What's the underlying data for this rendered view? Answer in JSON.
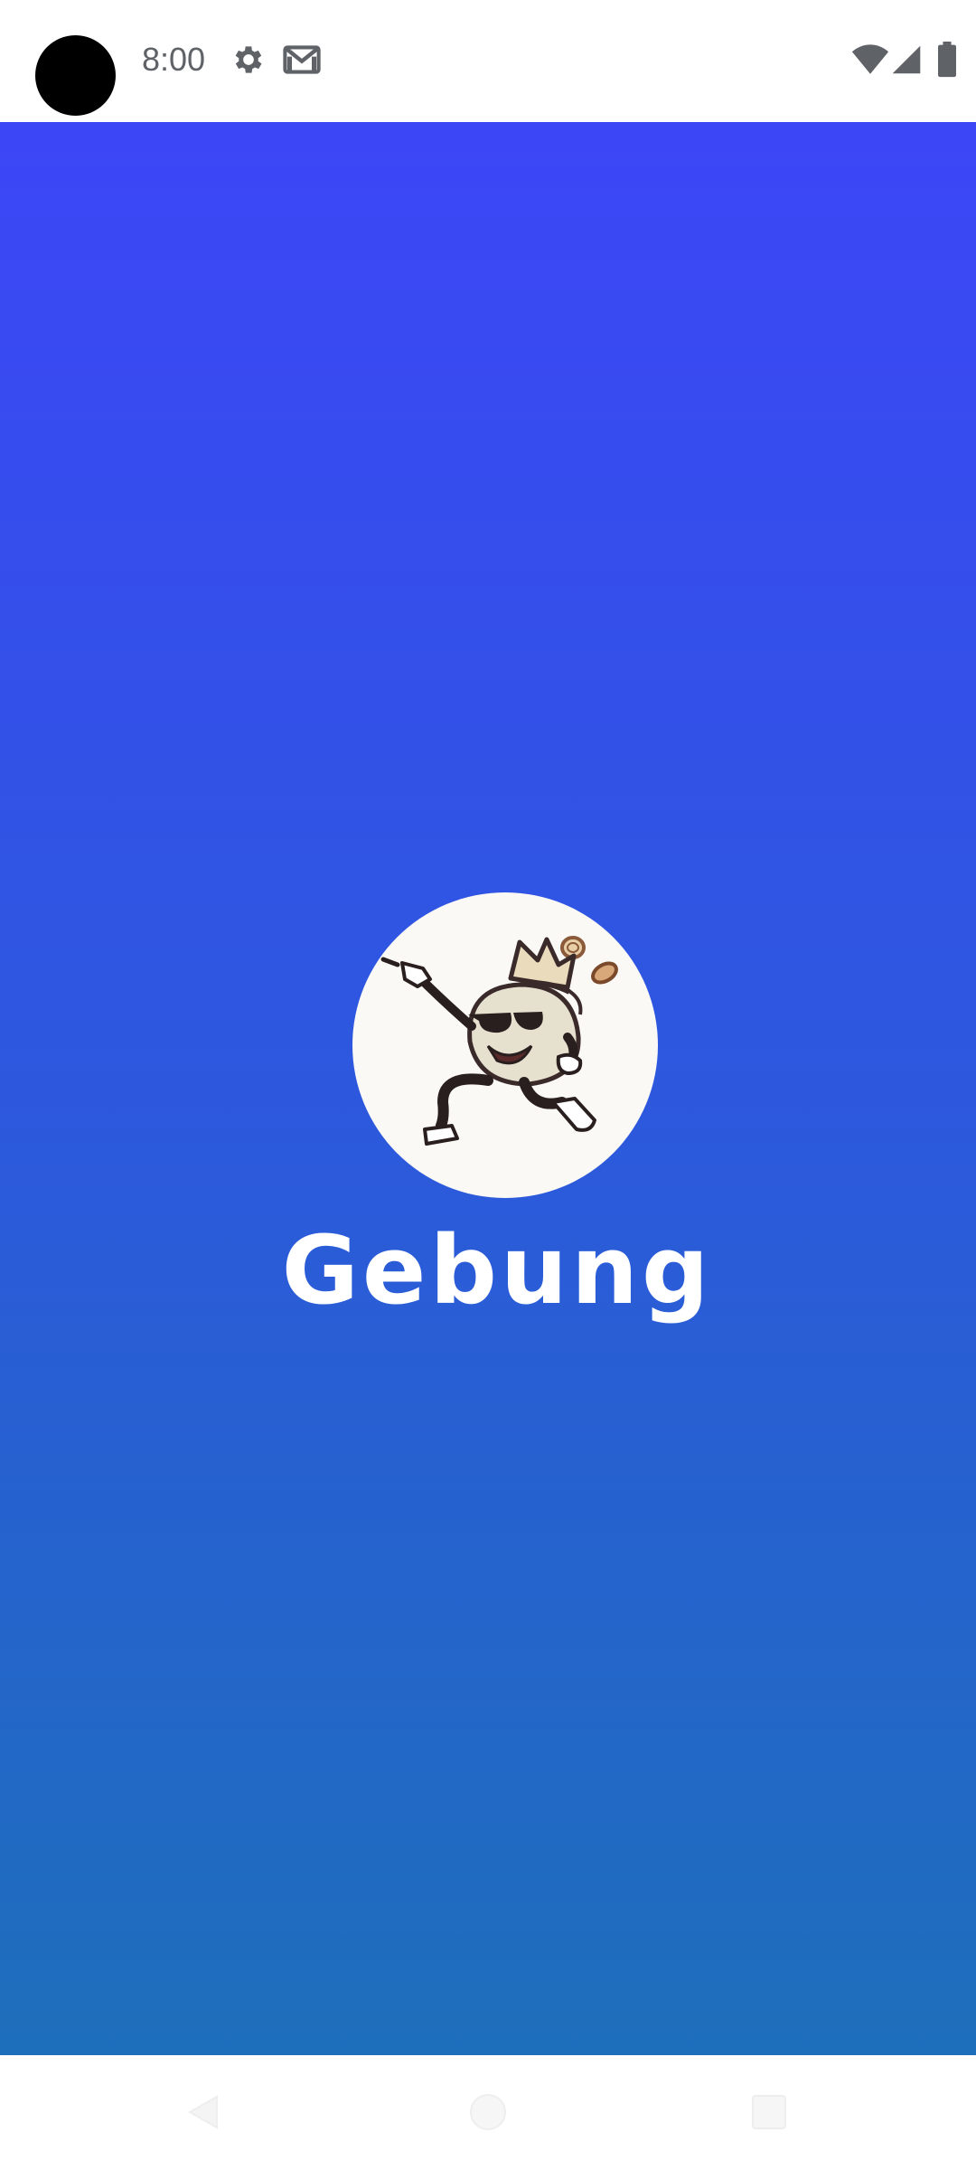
{
  "status_bar": {
    "time": "8:00",
    "icons": [
      "camera-cutout",
      "settings-icon",
      "gmail-icon",
      "wifi-icon",
      "cell-signal-icon",
      "battery-icon"
    ]
  },
  "splash": {
    "app_name": "Gebung",
    "logo": "money-bag-mascot-logo",
    "gradient_top": "#3c46f7",
    "gradient_bottom": "#1d6fbb"
  },
  "nav_bar": {
    "buttons": [
      "back-icon",
      "home-icon",
      "recents-icon"
    ]
  }
}
